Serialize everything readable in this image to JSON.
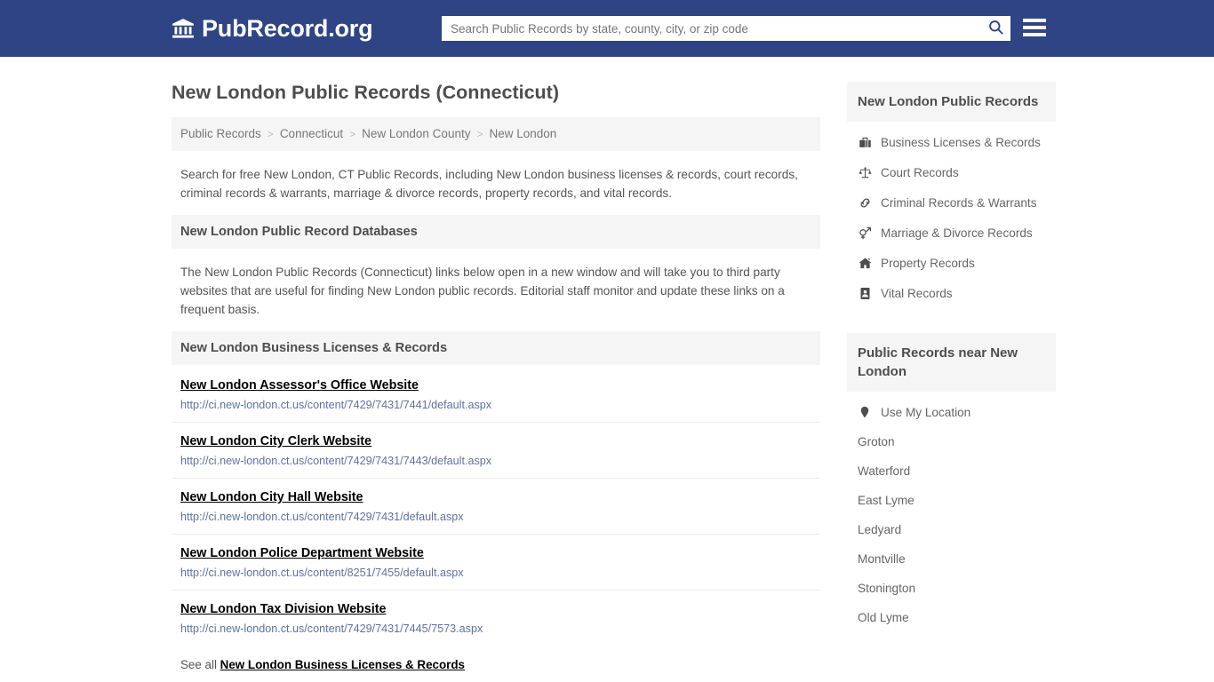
{
  "header": {
    "brand_name": "PubRecord.org",
    "brand_icon": "bank-building-icon",
    "search_placeholder": "Search Public Records by state, county, city, or zip code",
    "search_value": "",
    "search_icon": "search-icon",
    "menu_icon": "hamburger-menu-icon",
    "background_color": "#2e4484"
  },
  "main": {
    "page_title": "New London Public Records (Connecticut)",
    "breadcrumb": [
      "Public Records",
      "Connecticut",
      "New London County",
      "New London"
    ],
    "breadcrumb_separator": ">",
    "intro": "Search for free New London, CT Public Records, including New London business licenses & records, court records, criminal records & warrants, marriage & divorce records, property records, and vital records.",
    "databases_heading": "New London Public Record Databases",
    "databases_text": "The New London Public Records (Connecticut) links below open in a new window and will take you to third party websites that are useful for finding New London public records. Editorial staff monitor and update these links on a frequent basis.",
    "business_heading": "New London Business Licenses & Records",
    "links": [
      {
        "title": "New London Assessor's Office Website",
        "url": "http://ci.new-london.ct.us/content/7429/7431/7441/default.aspx"
      },
      {
        "title": "New London City Clerk Website",
        "url": "http://ci.new-london.ct.us/content/7429/7431/7443/default.aspx"
      },
      {
        "title": "New London City Hall Website",
        "url": "http://ci.new-london.ct.us/content/7429/7431/default.aspx"
      },
      {
        "title": "New London Police Department Website",
        "url": "http://ci.new-london.ct.us/content/8251/7455/default.aspx"
      },
      {
        "title": "New London Tax Division Website",
        "url": "http://ci.new-london.ct.us/content/7429/7431/7445/7573.aspx"
      }
    ],
    "see_all_prefix": "See all ",
    "see_all_link": "New London Business Licenses & Records"
  },
  "sidebar": {
    "records_heading": "New London Public Records",
    "record_items": [
      {
        "label": "Business Licenses & Records",
        "icon": "briefcase-icon"
      },
      {
        "label": "Court Records",
        "icon": "scales-of-justice-icon"
      },
      {
        "label": "Criminal Records & Warrants",
        "icon": "handcuffs-icon"
      },
      {
        "label": "Marriage & Divorce Records",
        "icon": "venus-mars-icon"
      },
      {
        "label": "Property Records",
        "icon": "home-icon"
      },
      {
        "label": "Vital Records",
        "icon": "id-card-icon"
      }
    ],
    "nearby_heading": "Public Records near New London",
    "use_my_location": {
      "label": "Use My Location",
      "icon": "map-pin-icon"
    },
    "nearby_cities": [
      "Groton",
      "Waterford",
      "East Lyme",
      "Ledyard",
      "Montville",
      "Stonington",
      "Old Lyme"
    ]
  },
  "colors": {
    "header_blue": "#2e4484",
    "panel_gray": "#f5f5f5",
    "link_blue": "#6071a3",
    "text_gray": "#555555"
  }
}
